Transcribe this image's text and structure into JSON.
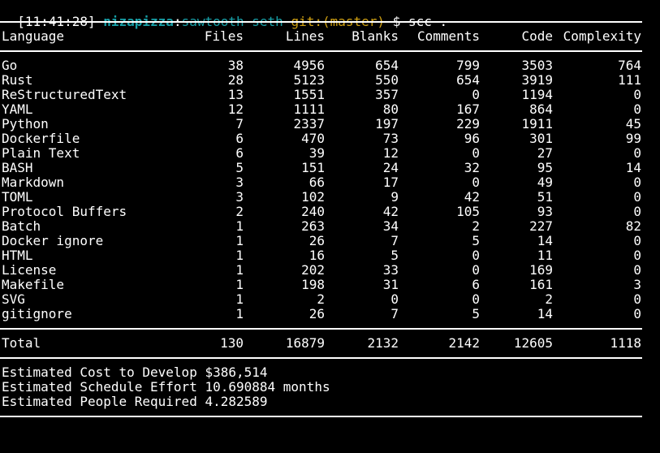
{
  "prompt": {
    "time": "[11:41:28]",
    "user": "nizapizza",
    "colon": ":",
    "host": "sawtooth-seth",
    "git": "git:(master)",
    "dollar": "$",
    "command": "scc ."
  },
  "table": {
    "headers": {
      "language": "Language",
      "files": "Files",
      "lines": "Lines",
      "blanks": "Blanks",
      "comments": "Comments",
      "code": "Code",
      "complexity": "Complexity"
    },
    "rows": [
      {
        "language": "Go",
        "files": "38",
        "lines": "4956",
        "blanks": "654",
        "comments": "799",
        "code": "3503",
        "complexity": "764"
      },
      {
        "language": "Rust",
        "files": "28",
        "lines": "5123",
        "blanks": "550",
        "comments": "654",
        "code": "3919",
        "complexity": "111"
      },
      {
        "language": "ReStructuredText",
        "files": "13",
        "lines": "1551",
        "blanks": "357",
        "comments": "0",
        "code": "1194",
        "complexity": "0"
      },
      {
        "language": "YAML",
        "files": "12",
        "lines": "1111",
        "blanks": "80",
        "comments": "167",
        "code": "864",
        "complexity": "0"
      },
      {
        "language": "Python",
        "files": "7",
        "lines": "2337",
        "blanks": "197",
        "comments": "229",
        "code": "1911",
        "complexity": "45"
      },
      {
        "language": "Dockerfile",
        "files": "6",
        "lines": "470",
        "blanks": "73",
        "comments": "96",
        "code": "301",
        "complexity": "99"
      },
      {
        "language": "Plain Text",
        "files": "6",
        "lines": "39",
        "blanks": "12",
        "comments": "0",
        "code": "27",
        "complexity": "0"
      },
      {
        "language": "BASH",
        "files": "5",
        "lines": "151",
        "blanks": "24",
        "comments": "32",
        "code": "95",
        "complexity": "14"
      },
      {
        "language": "Markdown",
        "files": "3",
        "lines": "66",
        "blanks": "17",
        "comments": "0",
        "code": "49",
        "complexity": "0"
      },
      {
        "language": "TOML",
        "files": "3",
        "lines": "102",
        "blanks": "9",
        "comments": "42",
        "code": "51",
        "complexity": "0"
      },
      {
        "language": "Protocol Buffers",
        "files": "2",
        "lines": "240",
        "blanks": "42",
        "comments": "105",
        "code": "93",
        "complexity": "0"
      },
      {
        "language": "Batch",
        "files": "1",
        "lines": "263",
        "blanks": "34",
        "comments": "2",
        "code": "227",
        "complexity": "82"
      },
      {
        "language": "Docker ignore",
        "files": "1",
        "lines": "26",
        "blanks": "7",
        "comments": "5",
        "code": "14",
        "complexity": "0"
      },
      {
        "language": "HTML",
        "files": "1",
        "lines": "16",
        "blanks": "5",
        "comments": "0",
        "code": "11",
        "complexity": "0"
      },
      {
        "language": "License",
        "files": "1",
        "lines": "202",
        "blanks": "33",
        "comments": "0",
        "code": "169",
        "complexity": "0"
      },
      {
        "language": "Makefile",
        "files": "1",
        "lines": "198",
        "blanks": "31",
        "comments": "6",
        "code": "161",
        "complexity": "3"
      },
      {
        "language": "SVG",
        "files": "1",
        "lines": "2",
        "blanks": "0",
        "comments": "0",
        "code": "2",
        "complexity": "0"
      },
      {
        "language": "gitignore",
        "files": "1",
        "lines": "26",
        "blanks": "7",
        "comments": "5",
        "code": "14",
        "complexity": "0"
      }
    ],
    "total": {
      "language": "Total",
      "files": "130",
      "lines": "16879",
      "blanks": "2132",
      "comments": "2142",
      "code": "12605",
      "complexity": "1118"
    }
  },
  "estimates": {
    "cost": "Estimated Cost to Develop $386,514",
    "schedule": "Estimated Schedule Effort 10.690884 months",
    "people": "Estimated People Required 4.282589"
  },
  "colors": {
    "background": "#000000",
    "text": "#ffffff",
    "prompt_user_host": "#17a0a8",
    "prompt_git": "#d0a011"
  }
}
